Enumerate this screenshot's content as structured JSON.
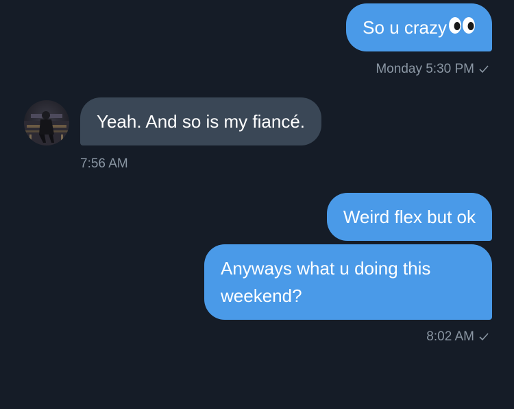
{
  "messages": [
    {
      "direction": "outgoing",
      "text": "So u crazy",
      "emoji": "eyes-emoji",
      "timestamp": "Monday 5:30 PM"
    },
    {
      "direction": "incoming",
      "text": "Yeah. And so is my fiancé.",
      "timestamp": "7:56 AM"
    },
    {
      "direction": "outgoing",
      "text": "Weird flex but ok"
    },
    {
      "direction": "outgoing",
      "text": "Anyways what u doing this weekend?",
      "timestamp": "8:02 AM"
    }
  ],
  "colors": {
    "background": "#151c27",
    "outgoing_bubble": "#4a9ae8",
    "incoming_bubble": "#3a4756",
    "meta_text": "#8a96a3"
  }
}
